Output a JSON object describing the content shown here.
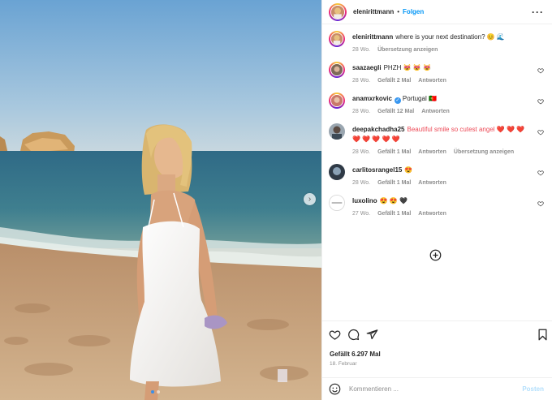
{
  "post": {
    "image_alt": "Frau in weißem Kleid am Strand bei Sonnenuntergang",
    "carousel_dots": 2,
    "active_dot": 0
  },
  "header": {
    "username": "elenirittmann",
    "separator": "•",
    "follow_label": "Folgen",
    "more_icon": "more-icon"
  },
  "caption": {
    "username": "elenirittmann",
    "text": "where is your next destination? 😊 🌊",
    "time": "28 Wo.",
    "translate": "Übersetzung anzeigen"
  },
  "comments": [
    {
      "username": "saazaegli",
      "text": "PHZH 😻 😻 😻",
      "time": "28 Wo.",
      "likes": "Gefällt 2 Mal",
      "reply": "Antworten",
      "verified": false
    },
    {
      "username": "anamxrkovic",
      "text": "Portugal 🇵🇹",
      "time": "28 Wo.",
      "likes": "Gefällt 12 Mal",
      "reply": "Antworten",
      "verified": true
    },
    {
      "username": "deepakchadha25",
      "text": "Beautiful smile so cutest angel ❤️ ❤️ ❤️ ❤️ ❤️ ❤️ ❤️ ❤️",
      "time": "28 Wo.",
      "likes": "Gefällt 1 Mal",
      "reply": "Antworten",
      "translate": "Übersetzung anzeigen",
      "verified": false
    },
    {
      "username": "carlitosrangel15",
      "text": "😍",
      "time": "28 Wo.",
      "likes": "Gefällt 1 Mal",
      "reply": "Antworten",
      "verified": false
    },
    {
      "username": "luxolino",
      "text": "😍 😍 🖤",
      "time": "27 Wo.",
      "likes": "Gefällt 1 Mal",
      "reply": "Antworten",
      "verified": false
    }
  ],
  "actions": {
    "likes": "Gefällt 6.297 Mal",
    "date": "18. Februar"
  },
  "comment_box": {
    "placeholder": "Kommentieren ...",
    "post_label": "Posten"
  },
  "colors": {
    "accent": "#0095f6",
    "text": "#262626",
    "muted": "#8e8e8e",
    "post_disabled": "#b2dffc"
  }
}
